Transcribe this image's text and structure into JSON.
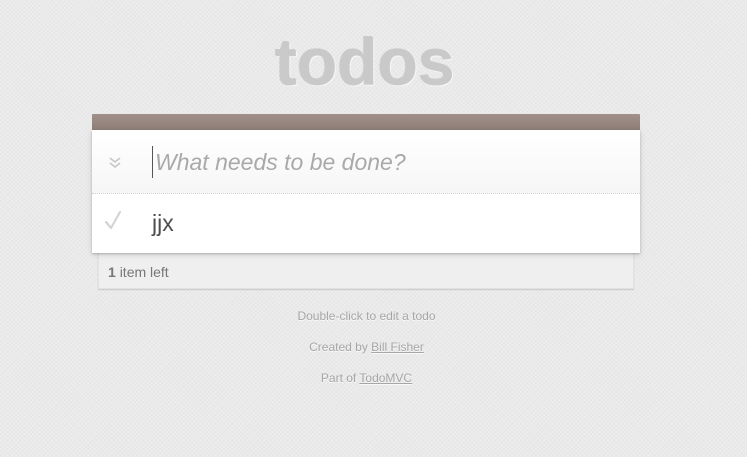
{
  "app": {
    "title": "todos"
  },
  "new_todo": {
    "placeholder": "What needs to be done?",
    "value": ""
  },
  "todos": [
    {
      "label": "jjx",
      "completed": false
    }
  ],
  "footer": {
    "count": "1",
    "count_suffix": "item left"
  },
  "info": {
    "edit_hint": "Double-click to edit a todo",
    "created_prefix": "Created by",
    "author": "Bill Fisher",
    "part_prefix": "Part of",
    "project": "TodoMVC"
  },
  "icons": {
    "toggle_all": "double-chevron-down-icon",
    "todo_check": "check-mark-icon"
  },
  "colors": {
    "header_bar": "#8d7d77",
    "background": "#eaeaea",
    "title": "#c8c8c8"
  }
}
